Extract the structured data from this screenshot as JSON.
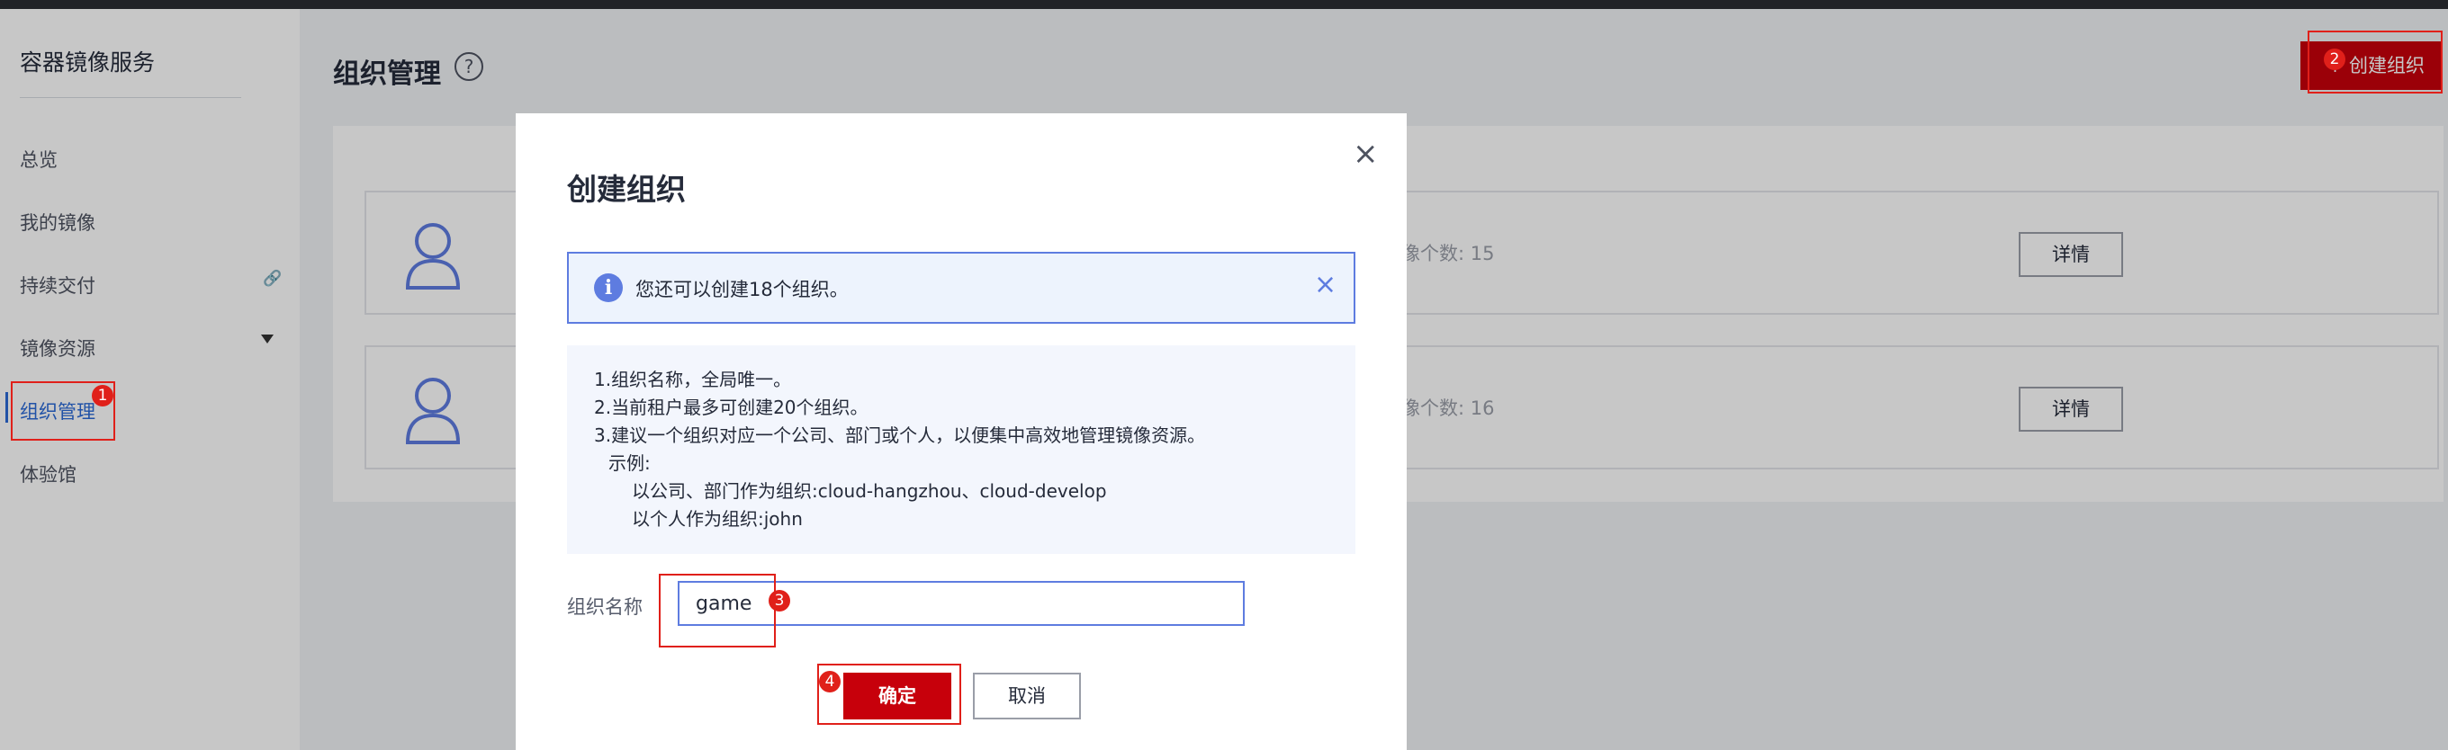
{
  "sidebar": {
    "title": "容器镜像服务",
    "items": [
      {
        "label": "总览"
      },
      {
        "label": "我的镜像"
      },
      {
        "label": "持续交付"
      },
      {
        "label": "镜像资源"
      },
      {
        "label": "组织管理"
      },
      {
        "label": "体验馆"
      }
    ],
    "active_item": "组织管理"
  },
  "header": {
    "title": "组织管理",
    "help_glyph": "?",
    "create_button_label": "+ 创建组织"
  },
  "organizations": [
    {
      "count_text": "像个数: 15",
      "detail_label": "详情"
    },
    {
      "count_text": "像个数: 16",
      "detail_label": "详情"
    }
  ],
  "dialog": {
    "title": "创建组织",
    "close_glyph": "×",
    "info": {
      "icon_glyph": "i",
      "text": "您还可以创建18个组织。",
      "close_glyph": "×"
    },
    "tips": [
      "1.组织名称，全局唯一。",
      "2.当前租户最多可创建20个组织。",
      "3.建议一个组织对应一个公司、部门或个人，以便集中高效地管理镜像资源。",
      "示例:",
      "以公司、部门作为组织:cloud-hangzhou、cloud-develop",
      "以个人作为组织:john"
    ],
    "field_label": "组织名称",
    "field_value": "game",
    "confirm_label": "确定",
    "cancel_label": "取消"
  },
  "annotations": [
    "1",
    "2",
    "3",
    "4"
  ],
  "colors": {
    "accent_red": "#c7000b",
    "annotation_red": "#e0201a",
    "link_blue": "#2b6ad6",
    "info_blue": "#5e7ce0"
  }
}
